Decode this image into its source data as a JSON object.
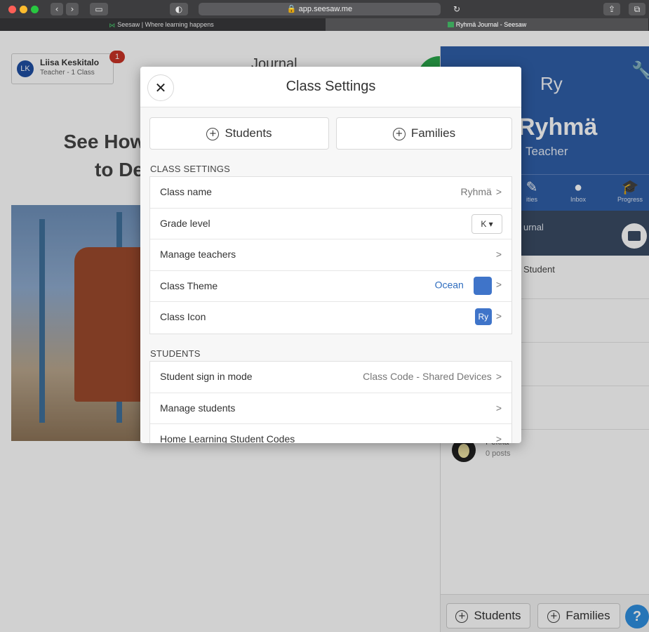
{
  "browser": {
    "url": "app.seesaw.me",
    "tabs": [
      {
        "label": "Seesaw | Where learning happens"
      },
      {
        "label": "Ryhmä Journal - Seesaw"
      }
    ]
  },
  "background": {
    "user_initials": "LK",
    "user_name": "Liisa Keskitalo",
    "user_subtitle": "Teacher - 1 Class",
    "notification_count": "1",
    "journal_title": "Journal",
    "headline_line1": "See How Se",
    "headline_line2": "to De"
  },
  "right_panel": {
    "class_short": "Ry",
    "class_name": "Ryhmä",
    "role": "Teacher",
    "nav": [
      {
        "label": "ities",
        "icon": "activities-icon"
      },
      {
        "label": "Inbox",
        "icon": "inbox-icon"
      },
      {
        "label": "Progress",
        "icon": "progress-icon"
      }
    ],
    "journal_label": "urnal",
    "rows": [
      {
        "label": "Student"
      },
      {
        "label": ""
      },
      {
        "label": ""
      },
      {
        "label": ""
      }
    ],
    "student_name": "Pekka",
    "student_posts": "0 posts",
    "footer_students": "Students",
    "footer_families": "Families",
    "help": "?"
  },
  "modal": {
    "title": "Class Settings",
    "close_symbol": "✕",
    "add_students": "Students",
    "add_families": "Families",
    "class_settings_header": "CLASS SETTINGS",
    "class_settings": [
      {
        "label": "Class name",
        "value": "Ryhmä"
      },
      {
        "label": "Grade level",
        "value": "K"
      },
      {
        "label": "Manage teachers",
        "value": ""
      },
      {
        "label": "Class Theme",
        "value": "Ocean"
      },
      {
        "label": "Class Icon",
        "value": "Ry"
      }
    ],
    "students_header": "STUDENTS",
    "students": [
      {
        "label": "Student sign in mode",
        "value": "Class Code - Shared Devices"
      },
      {
        "label": "Manage students",
        "value": ""
      },
      {
        "label": "Home Learning Student Codes",
        "value": ""
      }
    ],
    "chevron": ">",
    "theme_color": "#3f74c9"
  }
}
